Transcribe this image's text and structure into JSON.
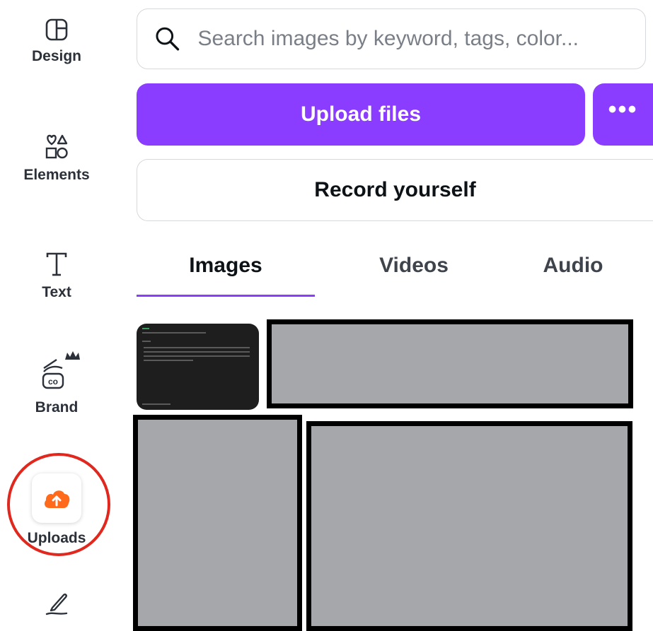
{
  "sidebar": {
    "items": [
      {
        "label": "Design",
        "icon": "layout-icon"
      },
      {
        "label": "Elements",
        "icon": "shapes-icon"
      },
      {
        "label": "Text",
        "icon": "text-t-icon"
      },
      {
        "label": "Brand",
        "icon": "brand-crown-icon"
      },
      {
        "label": "Uploads",
        "icon": "cloud-upload-icon"
      },
      {
        "label": "",
        "icon": "draw-pen-icon"
      }
    ],
    "active": "Uploads"
  },
  "search": {
    "placeholder": "Search images by keyword, tags, color..."
  },
  "actions": {
    "upload_label": "Upload files",
    "more_label": "•••",
    "record_label": "Record yourself"
  },
  "tabs": [
    {
      "label": "Images",
      "active": true
    },
    {
      "label": "Videos",
      "active": false
    },
    {
      "label": "Audio",
      "active": false
    }
  ],
  "colors": {
    "accent": "#8b3dff",
    "upload_icon": "#ff6b1a",
    "highlight_ring": "#e0281e",
    "placeholder_tile": "#a5a7aa"
  }
}
